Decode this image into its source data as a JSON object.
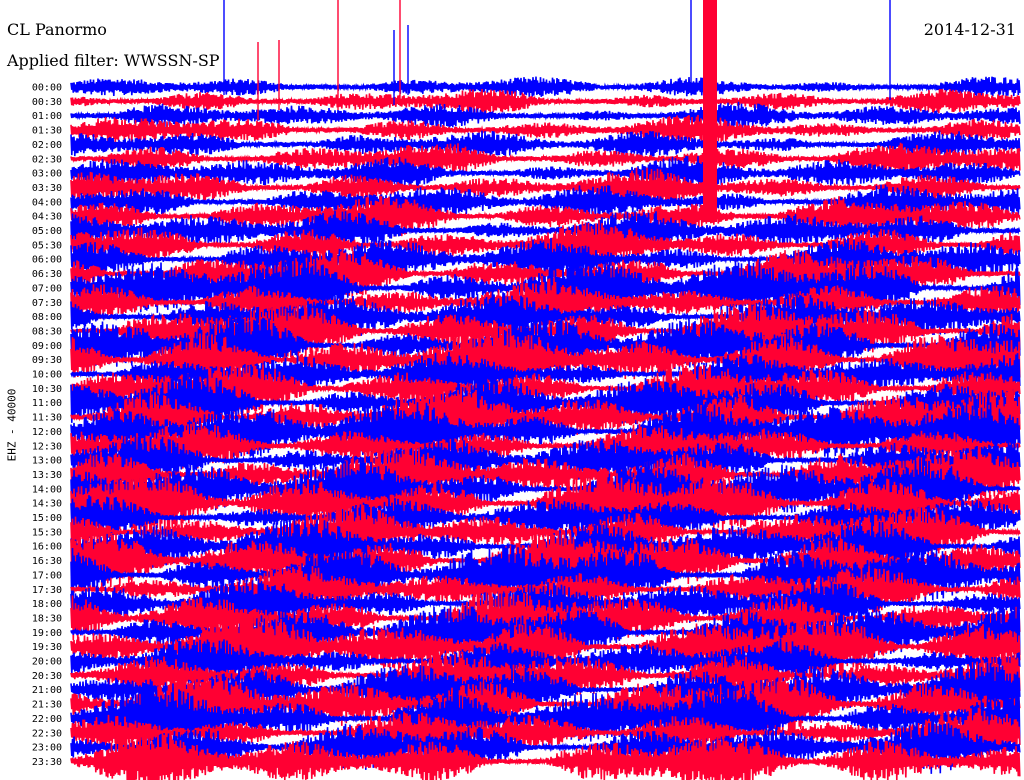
{
  "header": {
    "station": "CL Panormo",
    "date": "2014-12-31",
    "filter": "Applied filter: WWSSN-SP"
  },
  "chart_data": {
    "type": "line",
    "subtype": "helicorder",
    "ylabel": "EHZ - 40000",
    "row_labels": [
      "00:00",
      "00:30",
      "01:00",
      "01:30",
      "02:00",
      "02:30",
      "03:00",
      "03:30",
      "04:00",
      "04:30",
      "05:00",
      "05:30",
      "06:00",
      "06:30",
      "07:00",
      "07:30",
      "08:00",
      "08:30",
      "09:00",
      "09:30",
      "10:00",
      "10:30",
      "11:00",
      "11:30",
      "12:00",
      "12:30",
      "13:00",
      "13:30",
      "14:00",
      "14:30",
      "15:00",
      "15:30",
      "16:00",
      "16:30",
      "17:00",
      "17:30",
      "18:00",
      "18:30",
      "19:00",
      "19:30",
      "20:00",
      "20:30",
      "21:00",
      "21:30",
      "22:00",
      "22:30",
      "23:00",
      "23:30"
    ],
    "trace_colors": [
      "#0000ff",
      "#ff0033"
    ],
    "background": "#ffffff"
  }
}
